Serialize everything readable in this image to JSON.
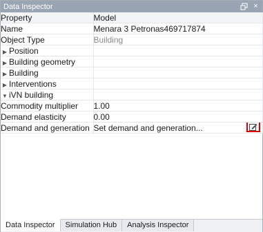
{
  "window": {
    "title": "Data Inspector"
  },
  "grid": {
    "header": {
      "property": "Property",
      "model": "Model"
    },
    "rows": [
      {
        "property": "Name",
        "value": "Menara 3 Petronas469717874"
      },
      {
        "property": "Object Type",
        "value": "Building"
      },
      {
        "property": "Position",
        "value": ""
      },
      {
        "property": "Building geometry",
        "value": ""
      },
      {
        "property": "Building",
        "value": ""
      },
      {
        "property": "Interventions",
        "value": ""
      },
      {
        "property": "iVN building",
        "value": ""
      },
      {
        "property": "Commodity multiplier",
        "value": "1.00"
      },
      {
        "property": "Demand elasticity",
        "value": "0.00"
      },
      {
        "property": "Demand and generation",
        "value": "Set demand and generation..."
      }
    ]
  },
  "tabs": [
    "Data Inspector",
    "Simulation Hub",
    "Analysis Inspector"
  ]
}
